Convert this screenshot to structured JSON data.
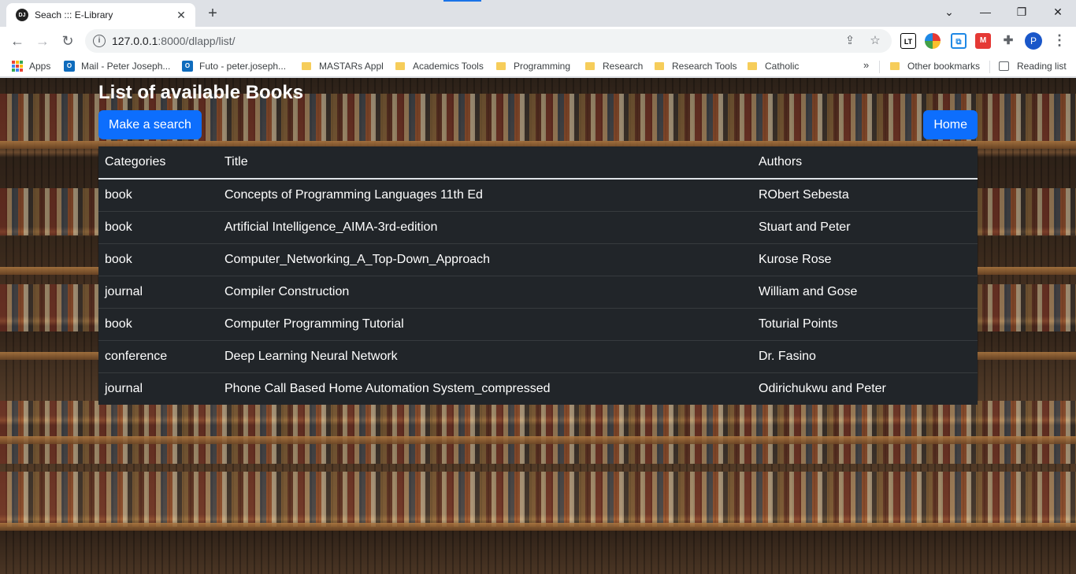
{
  "browser": {
    "tab_title": "Seach ::: E-Library",
    "favicon_text": "DJ",
    "url_host": "127.0.0.1",
    "url_rest": ":8000/dlapp/list/",
    "profile_initial": "P",
    "bookmarks": [
      {
        "label": "Apps",
        "icon": "apps-grid-icon"
      },
      {
        "label": "Mail - Peter Joseph...",
        "icon": "outlook-icon"
      },
      {
        "label": "Futo - peter.joseph...",
        "icon": "outlook-icon"
      },
      {
        "label": "MASTARs Appl",
        "icon": "folder-icon"
      },
      {
        "label": "Academics Tools",
        "icon": "folder-icon"
      },
      {
        "label": "Programming",
        "icon": "folder-icon"
      },
      {
        "label": "Research",
        "icon": "folder-icon"
      },
      {
        "label": "Research Tools",
        "icon": "folder-icon"
      },
      {
        "label": "Catholic",
        "icon": "folder-icon"
      }
    ],
    "other_bookmarks": "Other bookmarks",
    "reading_list": "Reading list"
  },
  "page": {
    "title": "List of available Books",
    "search_button": "Make a search",
    "home_button": "Home",
    "table": {
      "headers": [
        "Categories",
        "Title",
        "Authors"
      ],
      "rows": [
        {
          "category": "book",
          "title": "Concepts of Programming Languages 11th Ed",
          "authors": "RObert Sebesta"
        },
        {
          "category": "book",
          "title": "Artificial Intelligence_AIMA-3rd-edition",
          "authors": "Stuart and Peter"
        },
        {
          "category": "book",
          "title": "Computer_Networking_A_Top-Down_Approach",
          "authors": "Kurose Rose"
        },
        {
          "category": "journal",
          "title": "Compiler Construction",
          "authors": "William and Gose"
        },
        {
          "category": "book",
          "title": "Computer Programming Tutorial",
          "authors": "Toturial Points"
        },
        {
          "category": "conference",
          "title": "Deep Learning Neural Network",
          "authors": "Dr. Fasino"
        },
        {
          "category": "journal",
          "title": "Phone Call Based Home Automation System_compressed",
          "authors": "Odirichukwu and Peter"
        }
      ]
    }
  },
  "colors": {
    "primary_button": "#0d6efd",
    "table_bg": "#212529"
  }
}
